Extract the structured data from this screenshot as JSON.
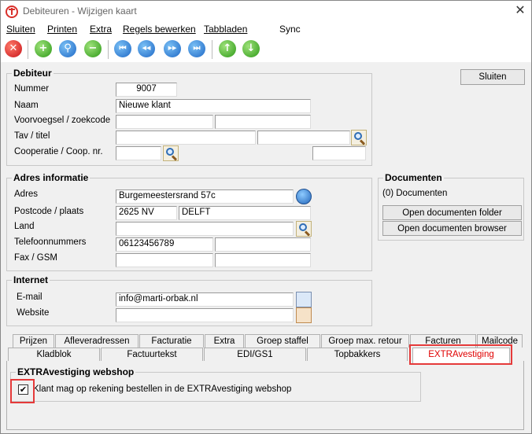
{
  "window": {
    "title": "Debiteuren - Wijzigen kaart",
    "close_glyph": "✕"
  },
  "menu": [
    {
      "label": "Sluiten"
    },
    {
      "label": "Printen"
    },
    {
      "label": "Extra"
    },
    {
      "label": "Regels bewerken"
    },
    {
      "label": "Tabbladen"
    },
    {
      "label": "Sync"
    }
  ],
  "toolbar": {
    "icons": [
      "close-icon",
      "add-icon",
      "search-icon",
      "remove-icon",
      "first-record-icon",
      "previous-record-icon",
      "next-record-icon",
      "last-record-icon",
      "move-up-icon",
      "move-down-icon"
    ],
    "glyphs": {
      "close": "✕",
      "add": "+",
      "search": "⚲",
      "remove": "−",
      "first": "⏮",
      "prev": "◀◀",
      "next": "▶▶",
      "last": "⏭",
      "up": "↑",
      "down": "↓"
    }
  },
  "sluiten_button": "Sluiten",
  "debiteur": {
    "title": "Debiteur",
    "nummer_label": "Nummer",
    "nummer_value": "9007",
    "naam_label": "Naam",
    "naam_value": "Nieuwe klant",
    "voorvoegsel_label": "Voorvoegsel / zoekcode",
    "voorvoegsel_value": "",
    "zoekcode_value": "",
    "tav_label": "Tav / titel",
    "tav_value": "",
    "titel_value": "",
    "cooperatie_label": "Cooperatie / Coop. nr.",
    "cooperatie_value": "",
    "coop_nr_value": ""
  },
  "adres": {
    "title": "Adres informatie",
    "adres_label": "Adres",
    "adres_value": "Burgemeestersrand 57c",
    "postcode_label": "Postcode / plaats",
    "postcode_value": "2625 NV",
    "plaats_value": "DELFT",
    "land_label": "Land",
    "land_value": "",
    "telefoon_label": "Telefoonnummers",
    "telefoon1_value": "06123456789",
    "telefoon2_value": "",
    "fax_label": "Fax / GSM",
    "fax_value": "",
    "gsm_value": ""
  },
  "documenten": {
    "title": "Documenten",
    "count_label": "(0) Documenten",
    "open_folder": "Open documenten folder",
    "open_browser": "Open documenten browser"
  },
  "internet": {
    "title": "Internet",
    "email_label": "E-mail",
    "email_value": "info@marti-orbak.nl",
    "website_label": "Website",
    "website_value": ""
  },
  "tabs_row1": [
    "Prijzen",
    "Afleveradressen",
    "Facturatie",
    "Extra",
    "Groep staffel",
    "Groep max. retour",
    "Facturen",
    "Mailcode"
  ],
  "tabs_row2": [
    "Kladblok",
    "Factuurtekst",
    "EDI/GS1",
    "Topbakkers",
    "EXTRAvestiging"
  ],
  "selected_tab": "EXTRAvestiging",
  "webshop": {
    "title": "EXTRAvestiging webshop",
    "checkbox_label": "Klant mag op rekening bestellen in de EXTRAvestiging webshop",
    "checked": true,
    "check_glyph": "✔"
  },
  "colors": {
    "highlight": "#e53a3a",
    "selected_tab_text": "#e00000"
  }
}
